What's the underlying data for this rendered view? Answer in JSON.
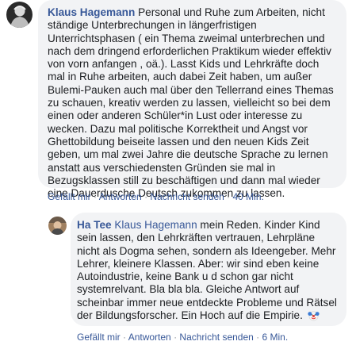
{
  "comment1": {
    "author": "Klaus Hagemann",
    "text": "Personal und Ruhe zum Arbeiten, nicht ständige Unterbrechungen in längerfristigen Unterrichtsphasen ( ein Thema zweimal unterbrechen und nach dem dringend erforderlichen Praktikum wieder effektiv von vorn anfangen , oä.). Lasst Kids und Lehrkräfte doch mal in Ruhe arbeiten, auch dabei Zeit haben, um außer Bulemi-Pauken auch mal über den Tellerrand eines Themas zu schauen, kreativ werden zu lassen, vielleicht so bei dem einen oder anderen Schüler*in Lust oder interesse zu wecken. Dazu mal politische Korrektheit und Angst vor Ghettobildung beiseite lassen und den neuen Kids Zeit geben, um mal zwei Jahre die deutsche Sprache zu lernen anstatt aus verschiedensten Gründen sie mal in Bezugsklassen still zu beschäftigen und dann mal wieder eine Dauerdusche Deutsch zukommen zu lassen.",
    "actions": {
      "like": "Gefällt mir",
      "reply": "Antworten",
      "message": "Nachricht senden",
      "time": "40 Min."
    }
  },
  "reply1": {
    "author": "Ha Tee",
    "mention": "Klaus Hagemann",
    "text": " mein Reden. Kinder Kind sein lassen, den Lehrkräften vertrauen, Lehrpläne nicht als Dogma sehen, sondern als Ideengeber. Mehr Lehrer, kleinere Klassen. Aber: wir sind eben keine Autoindustrie, keine Bank u d schon gar nicht systemrelvant. Bla bla bla. Gleiche Antwort auf scheinbar immer neue entdeckte Probleme und Rätsel der Bildungsforscher. Ein Hoch auf die Empirie.",
    "emoji": "clown-face-emoji",
    "actions": {
      "like": "Gefällt mir",
      "reply": "Antworten",
      "message": "Nachricht senden",
      "time": "6 Min."
    }
  },
  "separator": "·",
  "colors": {
    "bubble": "#f2f3f5",
    "name": "#385898",
    "meta": "#606770"
  }
}
